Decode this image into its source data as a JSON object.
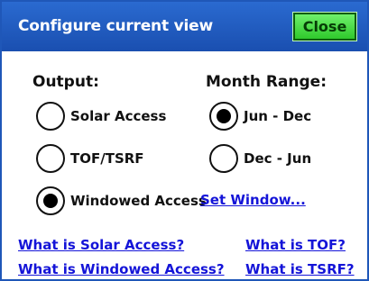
{
  "dialog": {
    "title": "Configure current view",
    "close_label": "Close"
  },
  "output": {
    "heading": "Output:",
    "options": [
      {
        "label": "Solar Access",
        "selected": false
      },
      {
        "label": "TOF/TSRF",
        "selected": false
      },
      {
        "label": "Windowed Access",
        "selected": true
      }
    ]
  },
  "month_range": {
    "heading": "Month Range:",
    "options": [
      {
        "label": "Jun - Dec",
        "selected": true
      },
      {
        "label": "Dec - Jun",
        "selected": false
      }
    ]
  },
  "links": {
    "set_window": "Set Window...",
    "what_solar_access": "What is Solar Access?",
    "what_windowed_access": "What is Windowed Access?",
    "what_tof": "What is TOF?",
    "what_tsrf": "What is TSRF?"
  },
  "colors": {
    "title_bar": "#1a4fb0",
    "close_button": "#2fc92c",
    "link": "#1414d8"
  }
}
